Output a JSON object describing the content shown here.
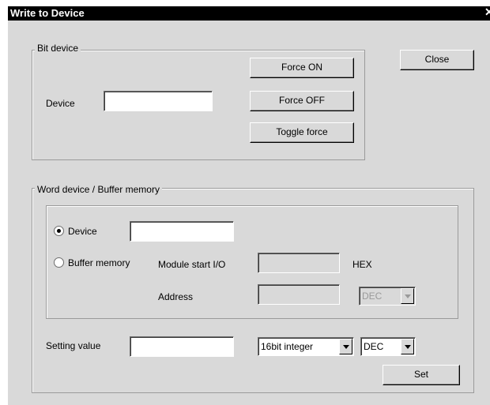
{
  "window": {
    "title": "Write to Device",
    "close_glyph": "✕"
  },
  "bit_device": {
    "group_label": "Bit device",
    "device_label": "Device",
    "device_value": "",
    "force_on_label": "Force ON",
    "force_off_label": "Force OFF",
    "toggle_force_label": "Toggle force"
  },
  "close_button_label": "Close",
  "word_device": {
    "group_label": "Word device / Buffer memory",
    "device_radio_label": "Device",
    "device_selected": true,
    "device_value": "",
    "buffer_radio_label": "Buffer memory",
    "module_start_label": "Module start I/O",
    "module_start_value": "",
    "hex_label": "HEX",
    "address_label": "Address",
    "address_value": "",
    "address_format": "DEC"
  },
  "setting": {
    "label": "Setting value",
    "value": "",
    "type_selected": "16bit integer",
    "format_selected": "DEC",
    "set_button_label": "Set"
  }
}
